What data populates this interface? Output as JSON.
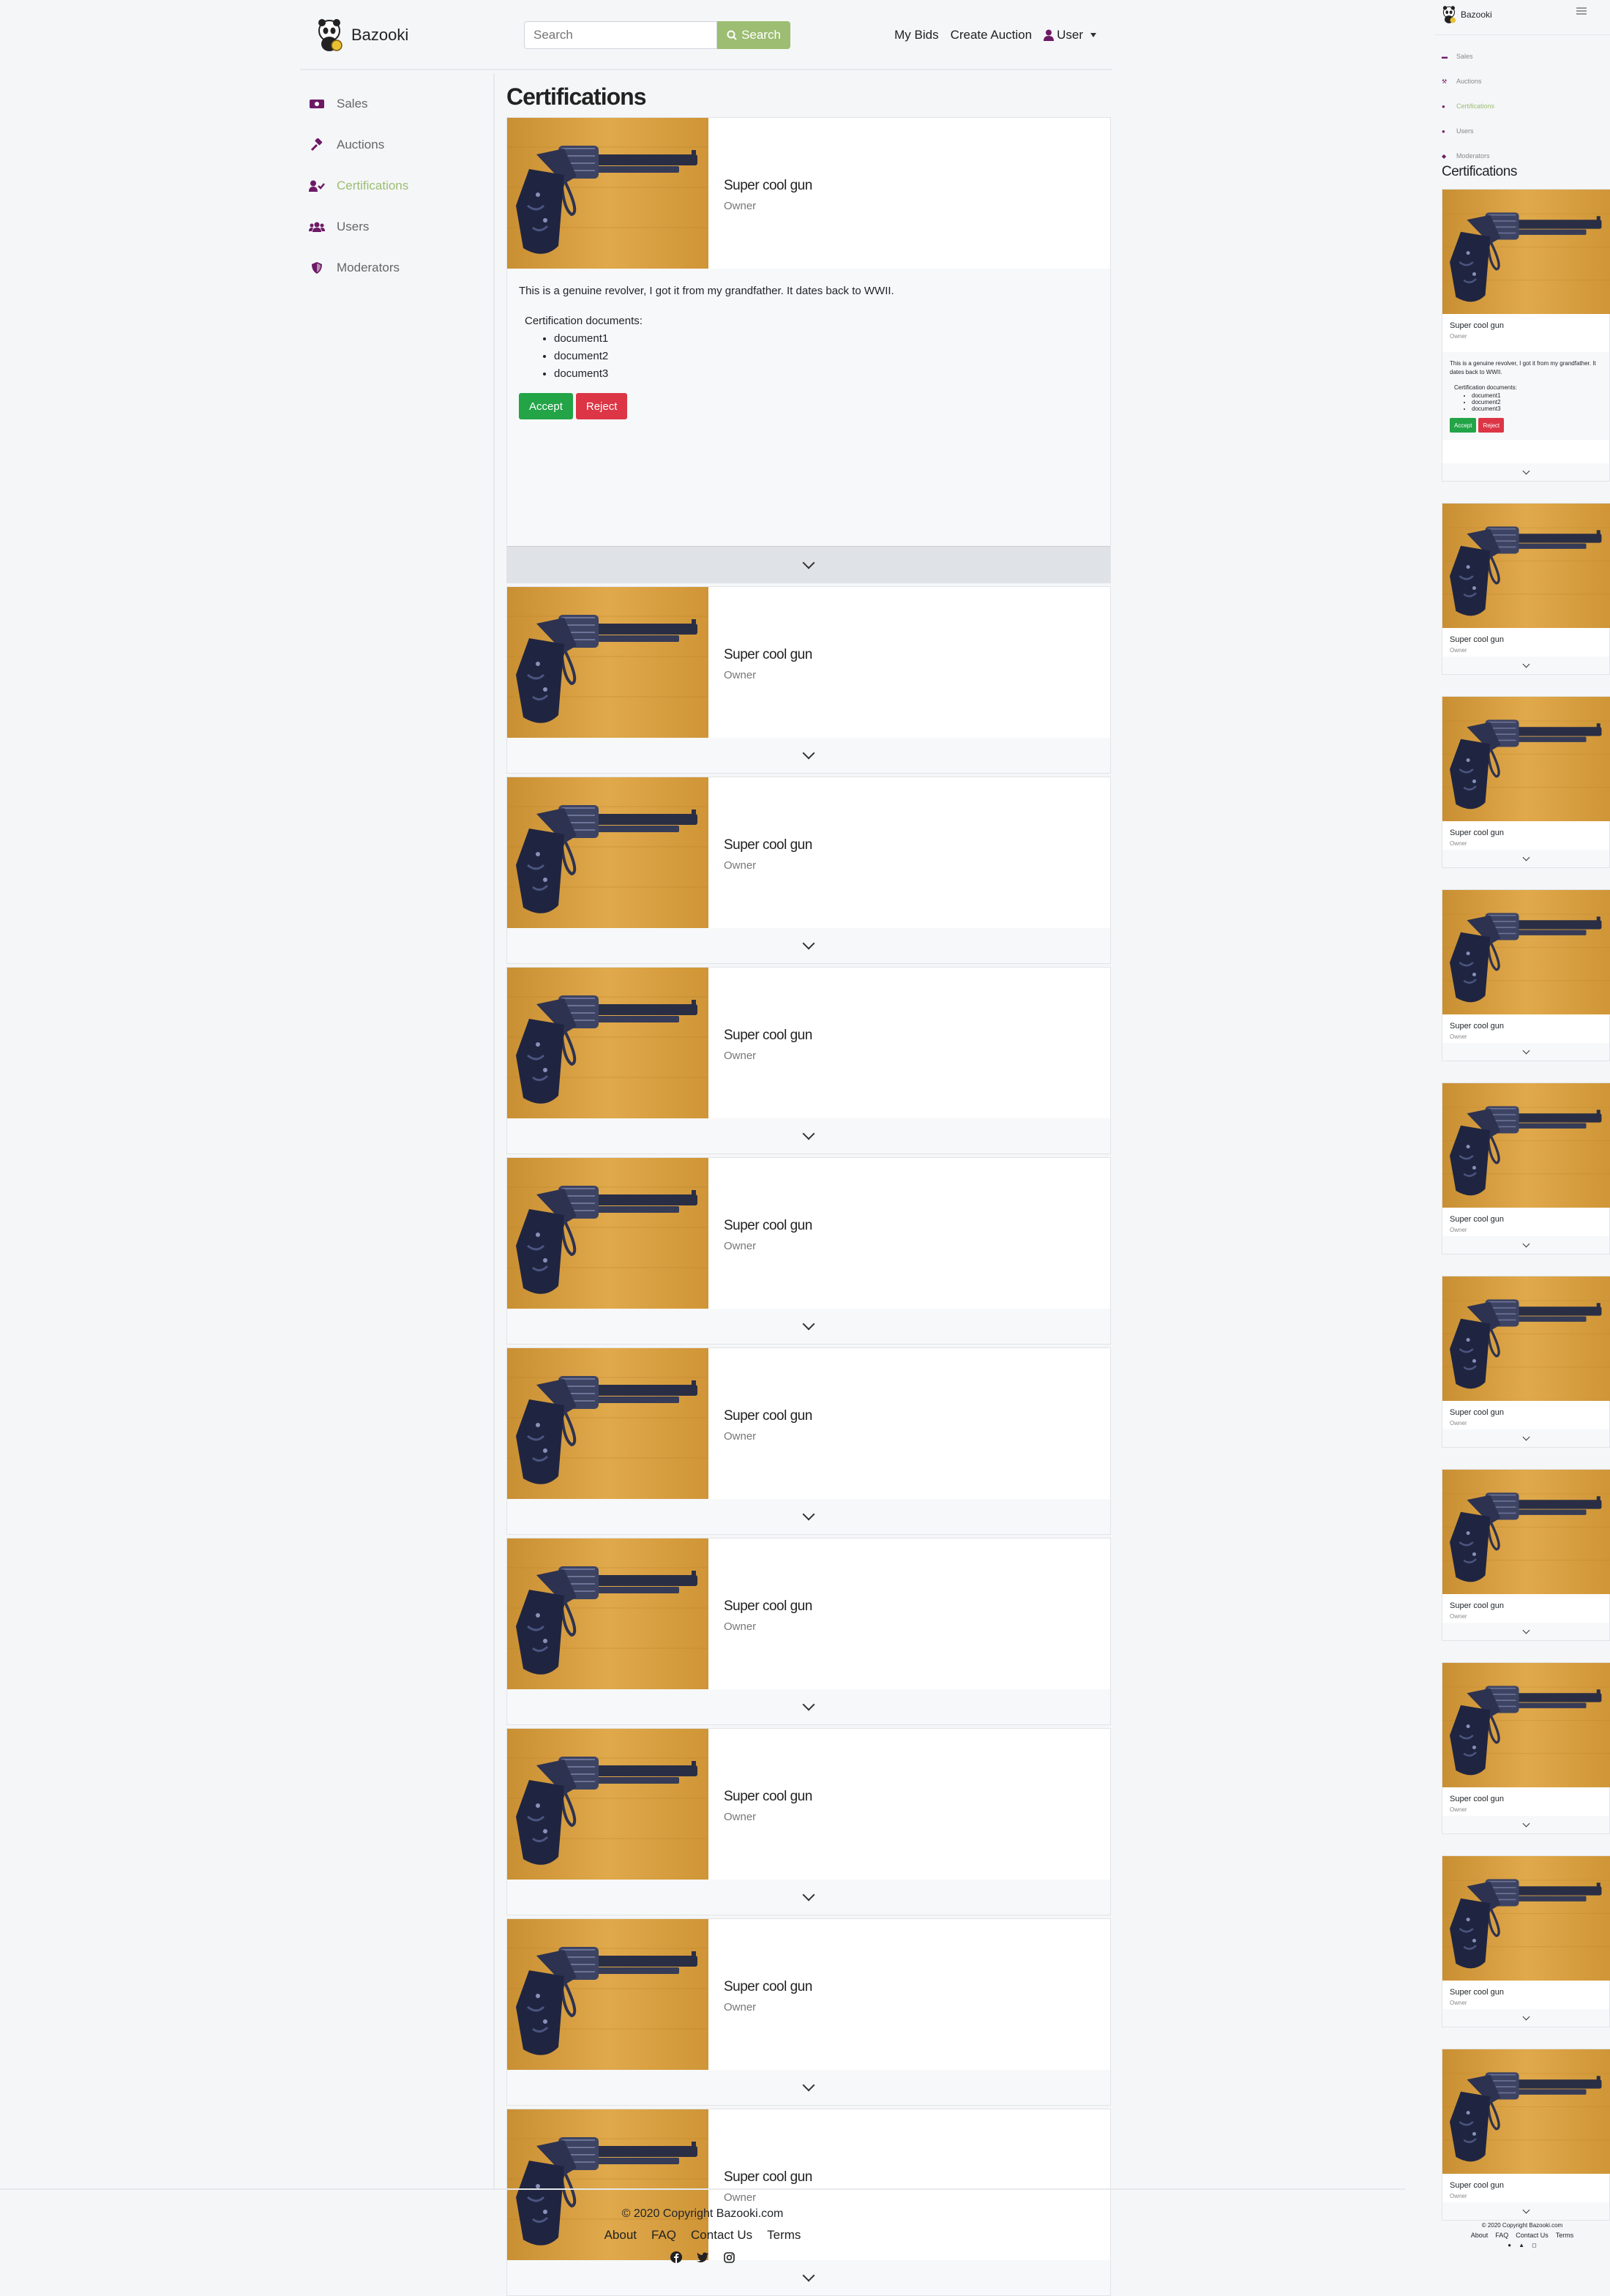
{
  "brand": {
    "name": "Bazooki"
  },
  "header": {
    "search_placeholder": "Search",
    "search_button": "Search",
    "links": [
      "My Bids",
      "Create Auction"
    ],
    "user_label": "User"
  },
  "sidebar": {
    "items": [
      {
        "label": "Sales",
        "icon": "money-bill-icon",
        "active": false
      },
      {
        "label": "Auctions",
        "icon": "gavel-icon",
        "active": false
      },
      {
        "label": "Certifications",
        "icon": "user-check-icon",
        "active": true
      },
      {
        "label": "Users",
        "icon": "users-icon",
        "active": false
      },
      {
        "label": "Moderators",
        "icon": "shield-icon",
        "active": false
      }
    ]
  },
  "page": {
    "title": "Certifications"
  },
  "certifications": [
    {
      "title": "Super cool gun",
      "owner": "Owner",
      "expanded": true,
      "description": "This is a genuine revolver, I got it from my grandfather. It dates back to WWII.",
      "documents_label": "Certification documents:",
      "documents": [
        "document1",
        "document2",
        "document3"
      ],
      "accept_label": "Accept",
      "reject_label": "Reject"
    },
    {
      "title": "Super cool gun",
      "owner": "Owner"
    },
    {
      "title": "Super cool gun",
      "owner": "Owner"
    },
    {
      "title": "Super cool gun",
      "owner": "Owner"
    },
    {
      "title": "Super cool gun",
      "owner": "Owner"
    },
    {
      "title": "Super cool gun",
      "owner": "Owner"
    },
    {
      "title": "Super cool gun",
      "owner": "Owner"
    },
    {
      "title": "Super cool gun",
      "owner": "Owner"
    },
    {
      "title": "Super cool gun",
      "owner": "Owner"
    },
    {
      "title": "Super cool gun",
      "owner": "Owner"
    }
  ],
  "footer": {
    "copyright": "© 2020 Copyright Bazooki.com",
    "links": [
      "About",
      "FAQ",
      "Contact Us",
      "Terms"
    ],
    "social_icons": [
      "facebook-icon",
      "twitter-icon",
      "instagram-icon"
    ]
  },
  "colors": {
    "accent": "#9cbd72",
    "icon": "#6d1a65",
    "accept": "#22a447",
    "reject": "#dc3545"
  }
}
